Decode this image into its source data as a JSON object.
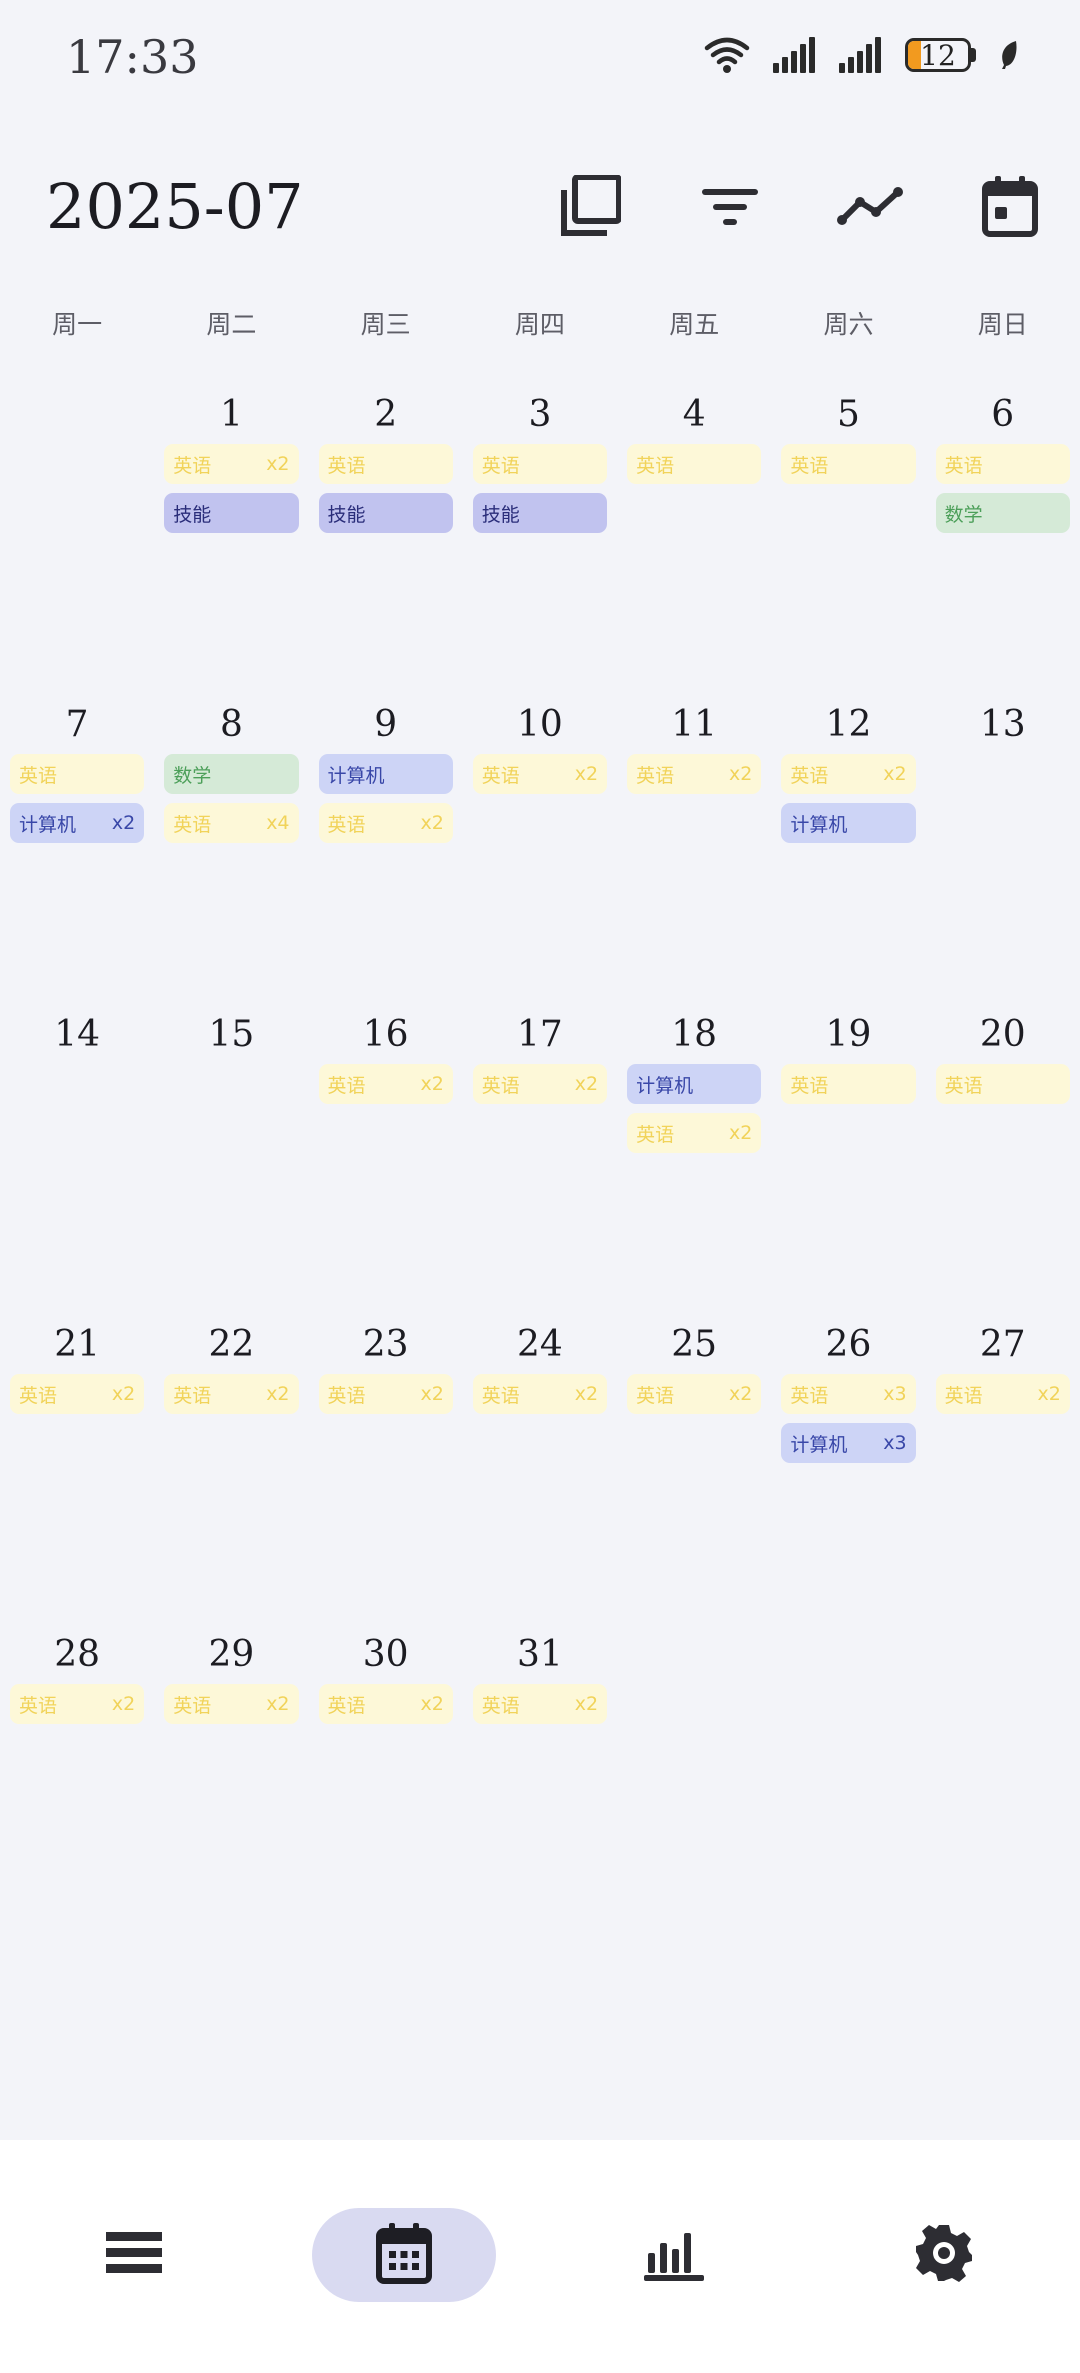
{
  "status": {
    "time": "17:33",
    "battery": "12"
  },
  "header": {
    "month": "2025-07"
  },
  "weekdays": [
    "周一",
    "周二",
    "周三",
    "周四",
    "周五",
    "周六",
    "周日"
  ],
  "weeks": [
    [
      {
        "day": "",
        "tags": []
      },
      {
        "day": "1",
        "tags": [
          {
            "type": "english",
            "label": "英语",
            "count": "x2"
          },
          {
            "type": "skill",
            "label": "技能",
            "count": ""
          }
        ]
      },
      {
        "day": "2",
        "tags": [
          {
            "type": "english",
            "label": "英语",
            "count": ""
          },
          {
            "type": "skill",
            "label": "技能",
            "count": ""
          }
        ]
      },
      {
        "day": "3",
        "tags": [
          {
            "type": "english",
            "label": "英语",
            "count": ""
          },
          {
            "type": "skill",
            "label": "技能",
            "count": ""
          }
        ]
      },
      {
        "day": "4",
        "tags": [
          {
            "type": "english",
            "label": "英语",
            "count": ""
          }
        ]
      },
      {
        "day": "5",
        "tags": [
          {
            "type": "english",
            "label": "英语",
            "count": ""
          }
        ]
      },
      {
        "day": "6",
        "tags": [
          {
            "type": "english",
            "label": "英语",
            "count": ""
          },
          {
            "type": "math",
            "label": "数学",
            "count": ""
          }
        ]
      }
    ],
    [
      {
        "day": "7",
        "tags": [
          {
            "type": "english",
            "label": "英语",
            "count": ""
          },
          {
            "type": "computer",
            "label": "计算机",
            "count": "x2"
          }
        ]
      },
      {
        "day": "8",
        "tags": [
          {
            "type": "math",
            "label": "数学",
            "count": ""
          },
          {
            "type": "english",
            "label": "英语",
            "count": "x4"
          }
        ]
      },
      {
        "day": "9",
        "tags": [
          {
            "type": "computer",
            "label": "计算机",
            "count": ""
          },
          {
            "type": "english",
            "label": "英语",
            "count": "x2"
          }
        ]
      },
      {
        "day": "10",
        "tags": [
          {
            "type": "english",
            "label": "英语",
            "count": "x2"
          }
        ]
      },
      {
        "day": "11",
        "tags": [
          {
            "type": "english",
            "label": "英语",
            "count": "x2"
          }
        ]
      },
      {
        "day": "12",
        "tags": [
          {
            "type": "english",
            "label": "英语",
            "count": "x2"
          },
          {
            "type": "computer",
            "label": "计算机",
            "count": ""
          }
        ]
      },
      {
        "day": "13",
        "tags": []
      }
    ],
    [
      {
        "day": "14",
        "tags": []
      },
      {
        "day": "15",
        "tags": []
      },
      {
        "day": "16",
        "tags": [
          {
            "type": "english",
            "label": "英语",
            "count": "x2"
          }
        ]
      },
      {
        "day": "17",
        "tags": [
          {
            "type": "english",
            "label": "英语",
            "count": "x2"
          }
        ]
      },
      {
        "day": "18",
        "tags": [
          {
            "type": "computer",
            "label": "计算机",
            "count": ""
          },
          {
            "type": "english",
            "label": "英语",
            "count": "x2"
          }
        ]
      },
      {
        "day": "19",
        "tags": [
          {
            "type": "english",
            "label": "英语",
            "count": ""
          }
        ]
      },
      {
        "day": "20",
        "tags": [
          {
            "type": "english",
            "label": "英语",
            "count": ""
          }
        ]
      }
    ],
    [
      {
        "day": "21",
        "tags": [
          {
            "type": "english",
            "label": "英语",
            "count": "x2"
          }
        ]
      },
      {
        "day": "22",
        "tags": [
          {
            "type": "english",
            "label": "英语",
            "count": "x2"
          }
        ]
      },
      {
        "day": "23",
        "tags": [
          {
            "type": "english",
            "label": "英语",
            "count": "x2"
          }
        ]
      },
      {
        "day": "24",
        "tags": [
          {
            "type": "english",
            "label": "英语",
            "count": "x2"
          }
        ]
      },
      {
        "day": "25",
        "tags": [
          {
            "type": "english",
            "label": "英语",
            "count": "x2"
          }
        ]
      },
      {
        "day": "26",
        "tags": [
          {
            "type": "english",
            "label": "英语",
            "count": "x3"
          },
          {
            "type": "computer",
            "label": "计算机",
            "count": "x3"
          }
        ]
      },
      {
        "day": "27",
        "tags": [
          {
            "type": "english",
            "label": "英语",
            "count": "x2"
          }
        ]
      }
    ],
    [
      {
        "day": "28",
        "tags": [
          {
            "type": "english",
            "label": "英语",
            "count": "x2"
          }
        ]
      },
      {
        "day": "29",
        "tags": [
          {
            "type": "english",
            "label": "英语",
            "count": "x2"
          }
        ]
      },
      {
        "day": "30",
        "tags": [
          {
            "type": "english",
            "label": "英语",
            "count": "x2"
          }
        ]
      },
      {
        "day": "31",
        "tags": [
          {
            "type": "english",
            "label": "英语",
            "count": "x2"
          }
        ]
      },
      {
        "day": "",
        "tags": []
      },
      {
        "day": "",
        "tags": []
      },
      {
        "day": "",
        "tags": []
      }
    ]
  ],
  "colors": {
    "english_bg": "#fdf8d8",
    "english_text": "#f1d35a",
    "skill_bg": "#c1c3ef",
    "skill_text": "#2a2d7a",
    "math_bg": "#d5ead7",
    "math_text": "#4c9f59",
    "computer_bg": "#cdd4f6",
    "computer_text": "#3947a8",
    "nav_active_bg": "#d9daf1"
  },
  "icons": {
    "header": [
      "copy-icon",
      "filter-icon",
      "trend-icon",
      "calendar-today-icon"
    ],
    "nav": [
      "list-icon",
      "calendar-icon",
      "stats-icon",
      "settings-icon"
    ],
    "nav_active": "calendar-icon"
  }
}
